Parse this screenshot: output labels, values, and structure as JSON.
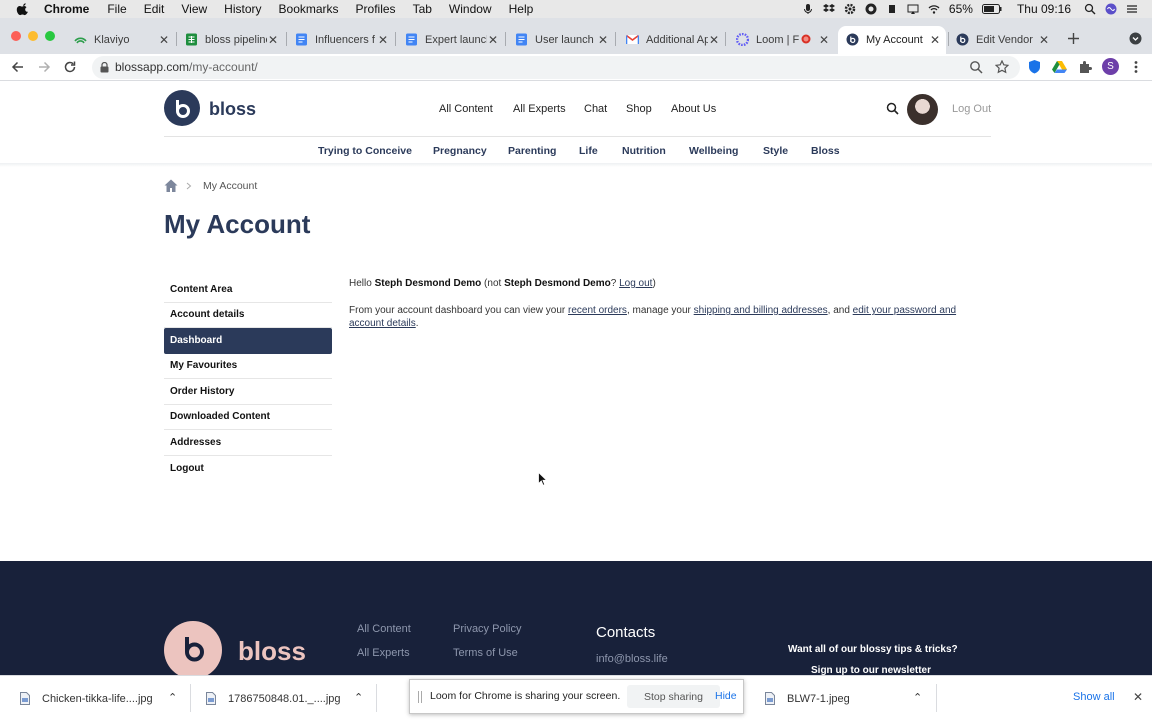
{
  "menubar": {
    "app": "Chrome",
    "items": [
      "File",
      "Edit",
      "View",
      "History",
      "Bookmarks",
      "Profiles",
      "Tab",
      "Window",
      "Help"
    ],
    "battery": "65%",
    "clock": "Thu 09:16"
  },
  "tabs": [
    {
      "title": "Klaviyo"
    },
    {
      "title": "bloss pipeline"
    },
    {
      "title": "Influencers f"
    },
    {
      "title": "Expert launch"
    },
    {
      "title": "User launch"
    },
    {
      "title": "Additional Ap"
    },
    {
      "title": "Loom | F"
    },
    {
      "title": "My Account"
    },
    {
      "title": "Edit Vendor"
    }
  ],
  "toolbar": {
    "url_host": "blossapp.com",
    "url_path": "/my-account/",
    "profile_initial": "S"
  },
  "site": {
    "logo": "bloss",
    "logo_letter": "b",
    "main_nav": [
      "All Content",
      "All Experts",
      "Chat",
      "Shop",
      "About Us"
    ],
    "log_out": "Log Out",
    "categories": [
      "Trying to Conceive",
      "Pregnancy",
      "Parenting",
      "Life",
      "Nutrition",
      "Wellbeing",
      "Style",
      "Bloss"
    ],
    "breadcrumb_current": "My Account",
    "page_title": "My Account",
    "side_menu": [
      "Content Area",
      "Account details",
      "Dashboard",
      "My Favourites",
      "Order History",
      "Downloaded Content",
      "Addresses",
      "Logout"
    ],
    "active_menu": "Dashboard",
    "greeting": {
      "hello": "Hello",
      "name": "Steph Desmond Demo",
      "not": "(not",
      "name2": "Steph Desmond Demo",
      "q": "?",
      "logout": "Log out",
      "close": ")"
    },
    "dashboard_text": {
      "p1": "From your account dashboard you can view your",
      "link1": "recent orders",
      "p2": ", manage your",
      "link2": "shipping and billing addresses",
      "p3": ", and",
      "link3": "edit your password and account details",
      "p4": "."
    }
  },
  "footer": {
    "logo": "bloss",
    "logo_letter": "b",
    "col1": [
      "All Content",
      "All Experts"
    ],
    "col2": [
      "Privacy Policy",
      "Terms of Use"
    ],
    "contacts_title": "Contacts",
    "email": "info@bloss.life",
    "newsletter_1": "Want all of our blossy tips & tricks?",
    "newsletter_2": "Sign up to our newsletter"
  },
  "downloads": [
    {
      "name": "Chicken-tikka-life....jpg"
    },
    {
      "name": "1786750848.01._....jpg"
    },
    {
      "name": "BLW7-1.jpeg"
    }
  ],
  "show_all": "Show all",
  "loom_bar": {
    "message": "Loom for Chrome is sharing your screen.",
    "stop": "Stop sharing",
    "hide": "Hide"
  },
  "colors": {
    "brand_navy": "#2b3a5a",
    "footer_bg": "#18213a",
    "footer_pink": "#ecc4bf"
  }
}
